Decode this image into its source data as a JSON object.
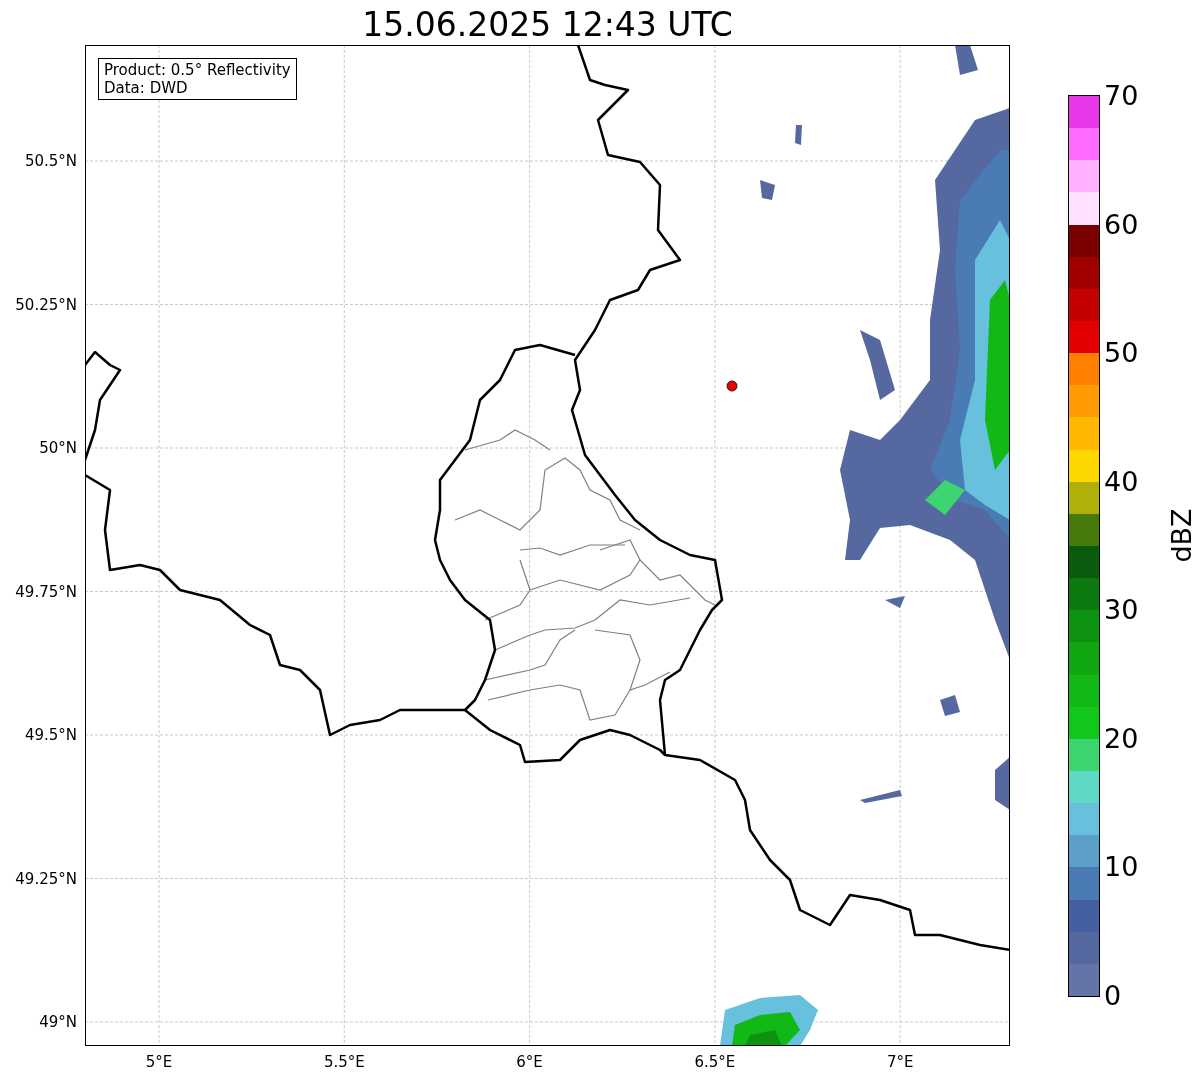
{
  "title": "15.06.2025 12:43 UTC",
  "info_box": [
    "Product: 0.5° Reflectivity",
    "Data: DWD"
  ],
  "map": {
    "kind": "map",
    "lat_ticks": [
      "50.5°N",
      "50.25°N",
      "50°N",
      "49.75°N",
      "49.5°N",
      "49.25°N",
      "49°N"
    ],
    "lon_ticks": [
      "5°E",
      "5.5°E",
      "6°E",
      "6.5°E",
      "7°E"
    ]
  },
  "colorbar": {
    "label": "dBZ",
    "ticks": [
      "70",
      "60",
      "50",
      "40",
      "30",
      "20",
      "10",
      "0"
    ],
    "segments": [
      {
        "color": "#e836e8"
      },
      {
        "color": "#ff6bff"
      },
      {
        "color": "#ffb0ff"
      },
      {
        "color": "#ffe0ff"
      },
      {
        "color": "#7a0000"
      },
      {
        "color": "#a00000"
      },
      {
        "color": "#c40000"
      },
      {
        "color": "#e30000"
      },
      {
        "color": "#ff7f00"
      },
      {
        "color": "#ff9a00"
      },
      {
        "color": "#ffb700"
      },
      {
        "color": "#ffd700"
      },
      {
        "color": "#afb10a"
      },
      {
        "color": "#467a0b"
      },
      {
        "color": "#095c0c"
      },
      {
        "color": "#0c7a10"
      },
      {
        "color": "#0e9212"
      },
      {
        "color": "#10a612"
      },
      {
        "color": "#11b816"
      },
      {
        "color": "#12c81c"
      },
      {
        "color": "#3dd570"
      },
      {
        "color": "#5fd8c4"
      },
      {
        "color": "#67c1dd"
      },
      {
        "color": "#5b9ec8"
      },
      {
        "color": "#4a7bb4"
      },
      {
        "color": "#4460a2"
      },
      {
        "color": "#55689f"
      },
      {
        "color": "#6374a6"
      }
    ]
  }
}
